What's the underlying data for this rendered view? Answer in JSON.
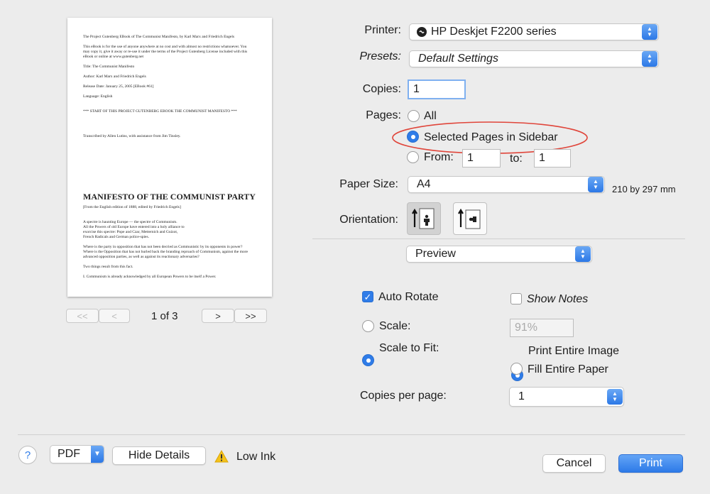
{
  "preview": {
    "lines": [
      "The Project Gutenberg EBook of The Communist Manifesto, by Karl Marx and Friedrich Engels",
      "",
      "This eBook is for the use of anyone anywhere at no cost and with almost no restrictions whatsoever. You",
      "may copy it, give it away or re-use it under the terms of the Project Gutenberg License included with this",
      "eBook or online at www.gutenberg.net",
      "",
      "Title: The Communist Manifesto",
      "",
      "Author: Karl Marx and Friedrich Engels",
      "",
      "Release Date: January 25, 2005 [EBook #61]",
      "",
      "Language: English",
      "",
      "",
      "*** START OF THIS PROJECT GUTENBERG EBOOK THE COMMUNIST MANIFESTO ***",
      "",
      "",
      "",
      "",
      "Transcribed by Allen Lutins, with assistance from Jim Tinsley."
    ],
    "heading": "MANIFESTO OF THE COMMUNIST PARTY",
    "body_lines": [
      "[From the English edition of 1888, edited by Friedrich Engels]",
      "",
      "",
      "A spectre is haunting Europe — the spectre of Communism.",
      "All the Powers of old Europe have entered into a holy alliance to",
      "exorcise this spectre: Pope and Czar, Metternich and Guizot,",
      "French Radicals and German police-spies.",
      "",
      "Where is the party in opposition that has not been decried as Communistic by its opponents in power?",
      "Where is the Opposition that has not hurled back the branding reproach of Communism, against the more",
      "advanced opposition parties, as well as against its reactionary adversaries?",
      "",
      "Two things result from this fact.",
      "",
      "I. Communism is already acknowledged by all European Powers to be itself a Power."
    ],
    "page_indicator": "1 of 3",
    "nav_first": "<<",
    "nav_prev": "<",
    "nav_next": ">",
    "nav_last": ">>"
  },
  "printer": {
    "label": "Printer:",
    "value": "HP Deskjet F2200 series"
  },
  "presets": {
    "label": "Presets:",
    "value": "Default Settings"
  },
  "copies": {
    "label": "Copies:",
    "value": "1"
  },
  "pages": {
    "label": "Pages:",
    "all": "All",
    "selected": "Selected Pages in Sidebar",
    "from_label": "From:",
    "from_value": "1",
    "to_label": "to:",
    "to_value": "1",
    "selected_option": "selected"
  },
  "paper_size": {
    "label": "Paper Size:",
    "value": "A4",
    "dimensions": "210 by 297 mm"
  },
  "orientation": {
    "label": "Orientation:",
    "selected": "portrait"
  },
  "section_popup": {
    "value": "Preview"
  },
  "preview_options": {
    "auto_rotate": "Auto Rotate",
    "auto_rotate_checked": true,
    "show_notes": "Show Notes",
    "show_notes_checked": false,
    "scale": "Scale:",
    "scale_value": "91%",
    "scale_to_fit": "Scale to Fit:",
    "print_entire_image": "Print Entire Image",
    "fill_entire_paper": "Fill Entire Paper",
    "copies_per_page_label": "Copies per page:",
    "copies_per_page_value": "1"
  },
  "footer": {
    "help": "?",
    "pdf": "PDF",
    "hide_details": "Hide Details",
    "low_ink": "Low Ink",
    "cancel": "Cancel",
    "print": "Print"
  },
  "colors": {
    "accent": "#2f7ce8",
    "annotation": "#e0453a"
  }
}
